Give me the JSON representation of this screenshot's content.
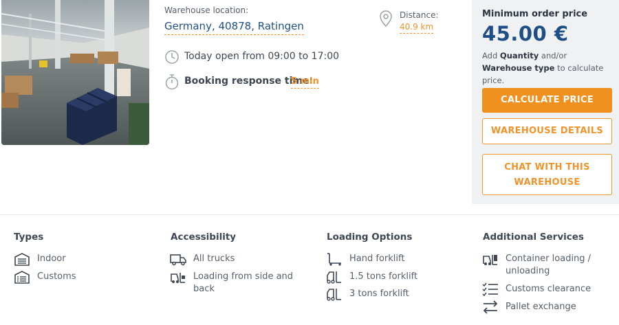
{
  "location": {
    "label": "Warehouse location:",
    "value": "Germany, 40878, Ratingen"
  },
  "distance": {
    "label": "Distance:",
    "value": "40.9 km",
    "icon": "map-pin-icon"
  },
  "hours": {
    "text": "Today open from 09:00 to 17:00",
    "icon": "clock-icon"
  },
  "booking": {
    "label": "Booking response time:",
    "value": "5 min",
    "icon": "stopwatch-icon"
  },
  "pricing": {
    "min_label": "Minimum order price",
    "price": "45.00 €",
    "hint_prefix": "Add ",
    "hint_qty": "Quantity",
    "hint_mid": " and/or ",
    "hint_type": "Warehouse type",
    "hint_suffix": " to calculate price.",
    "calculate_button": "CALCULATE PRICE",
    "details_button": "WAREHOUSE DETAILS",
    "chat_line1": "CHAT WITH THIS",
    "chat_line2": "WAREHOUSE"
  },
  "features": {
    "types": {
      "title": "Types",
      "items": [
        {
          "label": "Indoor",
          "icon": "warehouse-icon"
        },
        {
          "label": "Customs",
          "icon": "customs-building-icon"
        }
      ]
    },
    "accessibility": {
      "title": "Accessibility",
      "items": [
        {
          "label": "All trucks",
          "icon": "truck-icon"
        },
        {
          "label": "Loading from side and back",
          "icon": "forklift-loading-icon"
        }
      ]
    },
    "loading": {
      "title": "Loading Options",
      "items": [
        {
          "label": "Hand forklift",
          "icon": "hand-forklift-icon"
        },
        {
          "label": "1.5 tons forklift",
          "icon": "forklift-icon"
        },
        {
          "label": "3 tons forklift",
          "icon": "forklift-icon"
        }
      ]
    },
    "services": {
      "title": "Additional Services",
      "items": [
        {
          "label": "Container loading / unloading",
          "icon": "container-loading-icon"
        },
        {
          "label": "Customs clearance",
          "icon": "checklist-icon"
        },
        {
          "label": "Pallet exchange",
          "icon": "exchange-arrows-icon"
        }
      ]
    }
  },
  "colors": {
    "accent": "#f0901e",
    "brand_blue": "#1f4e86",
    "panel_bg": "#f0f1f2"
  }
}
